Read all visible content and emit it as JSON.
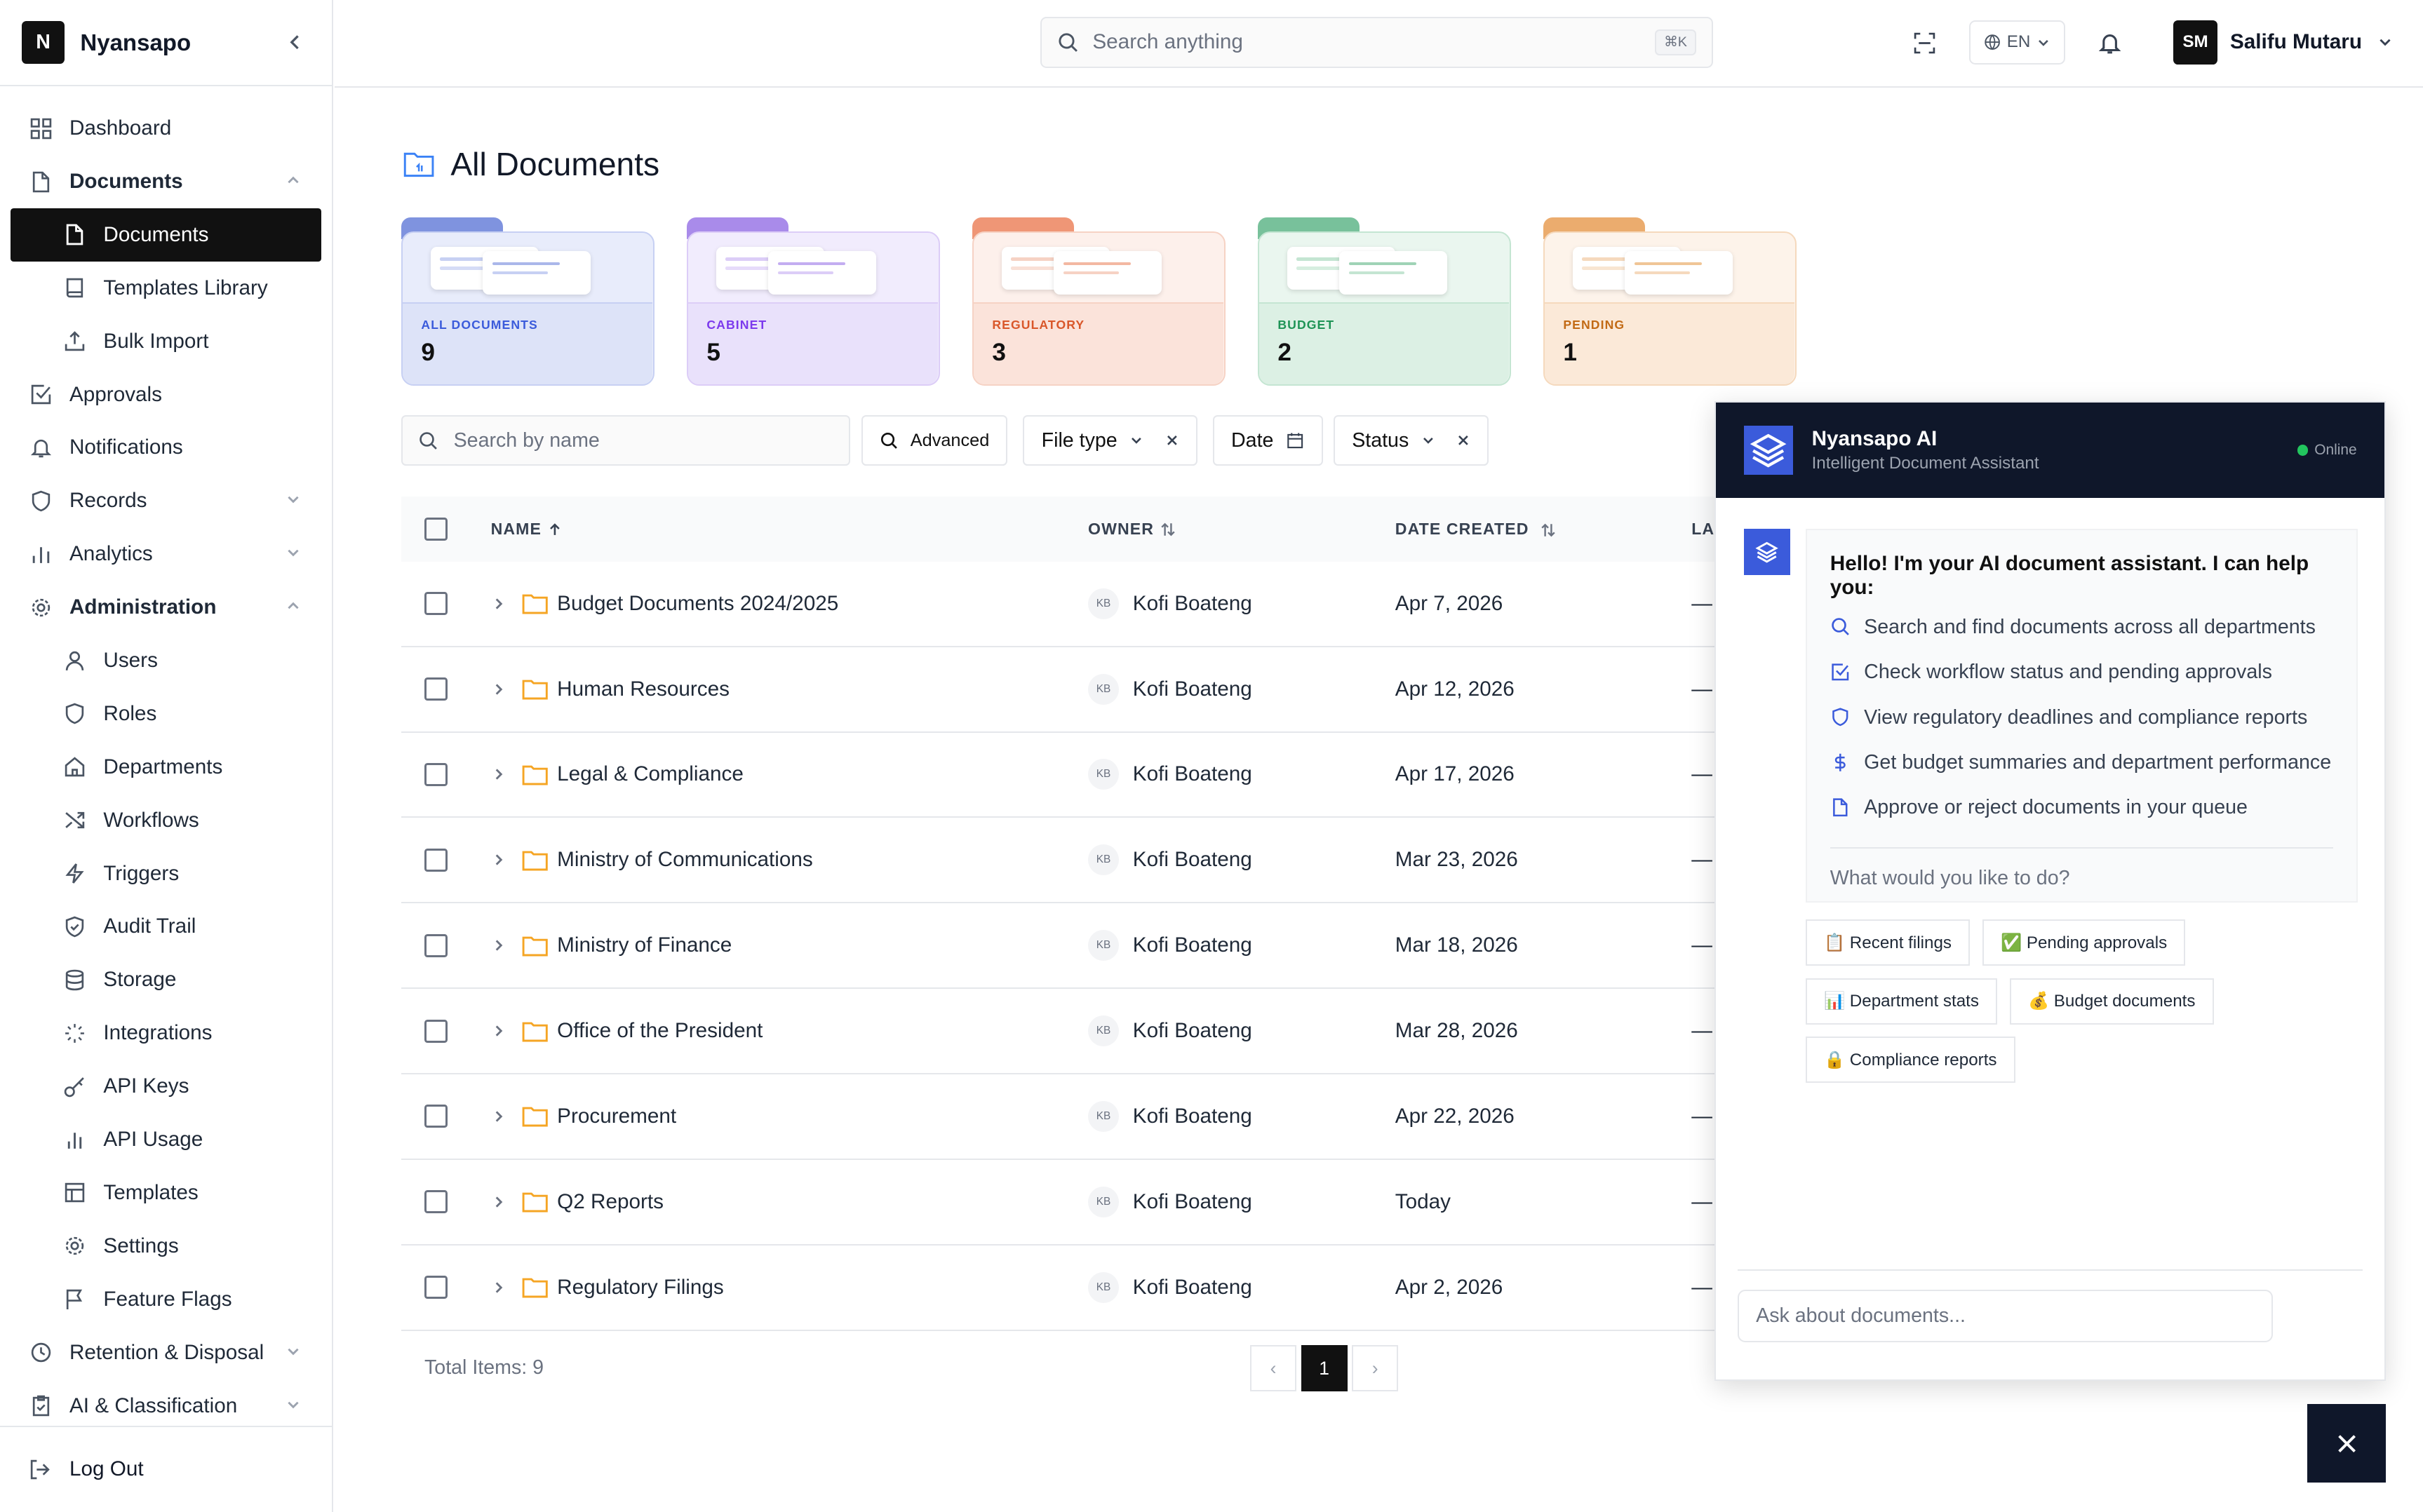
{
  "brand": {
    "logo": "N",
    "name": "Nyansapo"
  },
  "sidebar": {
    "items": [
      {
        "label": "Dashboard",
        "icon": "grid-icon"
      },
      {
        "label": "Documents",
        "icon": "file-icon"
      },
      {
        "label": "Documents",
        "icon": "file-icon"
      },
      {
        "label": "Templates Library",
        "icon": "book-icon"
      },
      {
        "label": "Bulk Import",
        "icon": "upload-icon"
      },
      {
        "label": "Approvals",
        "icon": "check-square-icon"
      },
      {
        "label": "Notifications",
        "icon": "bell-icon"
      },
      {
        "label": "Records",
        "icon": "shield-icon"
      },
      {
        "label": "Analytics",
        "icon": "bar-chart-icon"
      },
      {
        "label": "Administration",
        "icon": "gear-icon"
      },
      {
        "label": "Users",
        "icon": "user-icon"
      },
      {
        "label": "Roles",
        "icon": "shield-icon"
      },
      {
        "label": "Departments",
        "icon": "home-icon"
      },
      {
        "label": "Workflows",
        "icon": "shuffle-icon"
      },
      {
        "label": "Triggers",
        "icon": "zap-icon"
      },
      {
        "label": "Audit Trail",
        "icon": "shield-check-icon"
      },
      {
        "label": "Storage",
        "icon": "database-icon"
      },
      {
        "label": "Integrations",
        "icon": "loader-icon"
      },
      {
        "label": "API Keys",
        "icon": "key-icon"
      },
      {
        "label": "API Usage",
        "icon": "bar-chart-icon"
      },
      {
        "label": "Templates",
        "icon": "layout-icon"
      },
      {
        "label": "Settings",
        "icon": "gear-icon"
      },
      {
        "label": "Feature Flags",
        "icon": "flag-icon"
      },
      {
        "label": "Retention & Disposal",
        "icon": "clock-icon"
      },
      {
        "label": "AI & Classification",
        "icon": "clipboard-icon"
      }
    ],
    "logout": "Log Out"
  },
  "topbar": {
    "search_placeholder": "Search anything",
    "shortcut": "⌘K",
    "lang": "EN",
    "user_initials": "SM",
    "user_name": "Salifu Mutaru"
  },
  "page": {
    "title": "All Documents"
  },
  "cards": [
    {
      "label": "ALL DOCUMENTS",
      "count": "9",
      "accent": "#7b8fdc"
    },
    {
      "label": "CABINET",
      "count": "5",
      "accent": "#a98bea"
    },
    {
      "label": "REGULATORY",
      "count": "3",
      "accent": "#ef9676"
    },
    {
      "label": "BUDGET",
      "count": "2",
      "accent": "#78c19b"
    },
    {
      "label": "PENDING",
      "count": "1",
      "accent": "#ebac6e"
    }
  ],
  "filters": {
    "search_placeholder": "Search by name",
    "advanced": "Advanced",
    "file_type": "File type",
    "date": "Date",
    "status": "Status"
  },
  "table": {
    "columns": {
      "name": "NAME",
      "owner": "OWNER",
      "date_created": "DATE CREATED",
      "last": "LA"
    },
    "rows": [
      {
        "name": "Budget Documents 2024/2025",
        "owner_initials": "KB",
        "owner": "Kofi Boateng",
        "date": "Apr 7, 2026",
        "last": "—"
      },
      {
        "name": "Human Resources",
        "owner_initials": "KB",
        "owner": "Kofi Boateng",
        "date": "Apr 12, 2026",
        "last": "—"
      },
      {
        "name": "Legal & Compliance",
        "owner_initials": "KB",
        "owner": "Kofi Boateng",
        "date": "Apr 17, 2026",
        "last": "—"
      },
      {
        "name": "Ministry of Communications",
        "owner_initials": "KB",
        "owner": "Kofi Boateng",
        "date": "Mar 23, 2026",
        "last": "—"
      },
      {
        "name": "Ministry of Finance",
        "owner_initials": "KB",
        "owner": "Kofi Boateng",
        "date": "Mar 18, 2026",
        "last": "—"
      },
      {
        "name": "Office of the President",
        "owner_initials": "KB",
        "owner": "Kofi Boateng",
        "date": "Mar 28, 2026",
        "last": "—"
      },
      {
        "name": "Procurement",
        "owner_initials": "KB",
        "owner": "Kofi Boateng",
        "date": "Apr 22, 2026",
        "last": "—"
      },
      {
        "name": "Q2 Reports",
        "owner_initials": "KB",
        "owner": "Kofi Boateng",
        "date": "Today",
        "last": "—"
      },
      {
        "name": "Regulatory Filings",
        "owner_initials": "KB",
        "owner": "Kofi Boateng",
        "date": "Apr 2, 2026",
        "last": "—"
      }
    ],
    "total": "Total Items: 9",
    "page": "1",
    "prev": "‹",
    "next": "›"
  },
  "ai": {
    "title": "Nyansapo AI",
    "subtitle": "Intelligent Document Assistant",
    "status": "Online",
    "greeting": "Hello! I'm your AI document assistant. I can help you:",
    "capabilities": [
      {
        "text": "Search and find documents across all departments",
        "icon": "search-icon"
      },
      {
        "text": "Check workflow status and pending approvals",
        "icon": "check-square-icon"
      },
      {
        "text": "View regulatory deadlines and compliance reports",
        "icon": "shield-icon"
      },
      {
        "text": "Get budget summaries and department performance",
        "icon": "dollar-icon"
      },
      {
        "text": "Approve or reject documents in your queue",
        "icon": "file-icon"
      }
    ],
    "question": "What would you like to do?",
    "chips": [
      "📋 Recent filings",
      "✅ Pending approvals",
      "📊 Department stats",
      "💰 Budget documents",
      "🔒 Compliance reports"
    ],
    "input_placeholder": "Ask about documents..."
  }
}
